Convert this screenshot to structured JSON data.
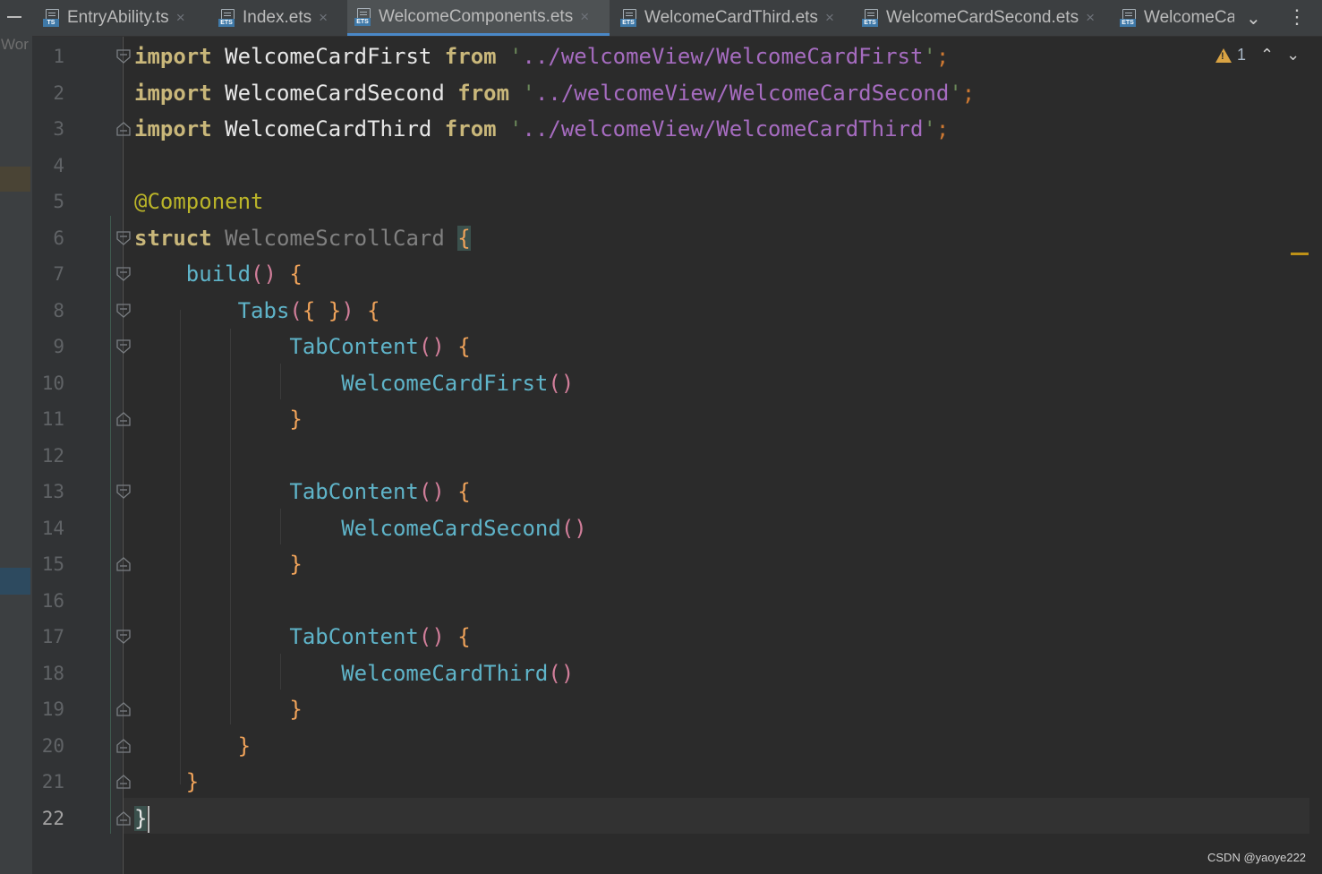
{
  "sidebar": {
    "label": "Wor"
  },
  "tabs": [
    {
      "label": "EntryAbility.ts",
      "badge": "TS",
      "active": false
    },
    {
      "label": "Index.ets",
      "badge": "ETS",
      "active": false
    },
    {
      "label": "WelcomeComponents.ets",
      "badge": "ETS",
      "active": true
    },
    {
      "label": "WelcomeCardThird.ets",
      "badge": "ETS",
      "active": false
    },
    {
      "label": "WelcomeCardSecond.ets",
      "badge": "ETS",
      "active": false
    },
    {
      "label": "WelcomeCa",
      "badge": "ETS",
      "active": false
    }
  ],
  "tab_close_glyph": "×",
  "editor": {
    "warning_count": "1",
    "line_numbers": [
      "1",
      "2",
      "3",
      "4",
      "5",
      "6",
      "7",
      "8",
      "9",
      "10",
      "11",
      "12",
      "13",
      "14",
      "15",
      "16",
      "17",
      "18",
      "19",
      "20",
      "21",
      "22"
    ],
    "current_line": "22",
    "lines": [
      "import WelcomeCardFirst from '../welcomeView/WelcomeCardFirst';",
      "import WelcomeCardSecond from '../welcomeView/WelcomeCardSecond';",
      "import WelcomeCardThird from '../welcomeView/WelcomeCardThird';",
      "",
      "@Component",
      "struct WelcomeScrollCard {",
      "    build() {",
      "        Tabs({ }) {",
      "            TabContent() {",
      "                WelcomeCardFirst()",
      "            }",
      "",
      "            TabContent() {",
      "                WelcomeCardSecond()",
      "            }",
      "",
      "            TabContent() {",
      "                WelcomeCardThird()",
      "            }",
      "        }",
      "    }",
      "}"
    ]
  },
  "icons": {
    "tab_file": "ets-file-icon",
    "fold": "fold-marker-icon",
    "warning": "warning-icon",
    "more": "kebab-menu-icon",
    "overflow": "chevron-down-icon"
  },
  "colors": {
    "keyword": "#cc7832",
    "string": "#a66cc0",
    "function": "#5fb4c9",
    "annotation": "#bbb529",
    "brace": "#f0a35a",
    "active_tab_underline": "#4a88c7"
  },
  "watermark": "CSDN @yaoye222"
}
